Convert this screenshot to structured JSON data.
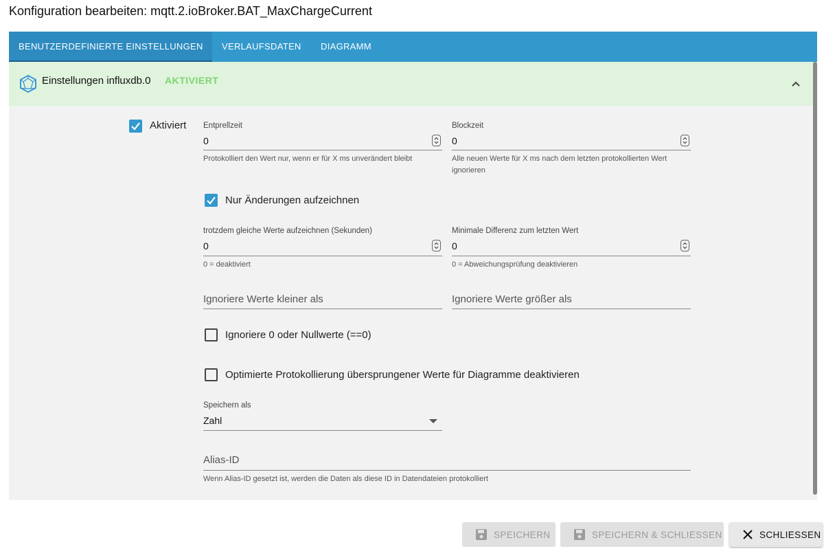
{
  "dialog": {
    "title": "Konfiguration bearbeiten: mqtt.2.ioBroker.BAT_MaxChargeCurrent"
  },
  "tabs": [
    {
      "label": "BENUTZERDEFINIERTE EINSTELLUNGEN",
      "active": true
    },
    {
      "label": "VERLAUFSDATEN",
      "active": false
    },
    {
      "label": "DIAGRAMM",
      "active": false
    }
  ],
  "panel": {
    "title": "Einstellungen influxdb.0",
    "status": "AKTIVIERT",
    "status_color": "#7ed56f",
    "icon": "influxdb-icon",
    "collapse_icon": "chevron-up-icon"
  },
  "form": {
    "enabled": {
      "label": "Aktiviert",
      "checked": true
    },
    "debounce": {
      "label": "Entprellzeit",
      "value": "0",
      "help": "Protokolliert den Wert nur, wenn er für X ms unverändert bleibt"
    },
    "blocktime": {
      "label": "Blockzeit",
      "value": "0",
      "help": "Alle neuen Werte für X ms nach dem letzten protokollierten Wert ignorieren"
    },
    "changes_only": {
      "label": "Nur Änderungen aufzeichnen",
      "checked": true
    },
    "change_min": {
      "label": "trotzdem gleiche Werte aufzeichnen (Sekunden)",
      "value": "0",
      "help": "0 = deaktiviert"
    },
    "min_diff": {
      "label": "Minimale Differenz zum letzten Wert",
      "value": "0",
      "help": "0 = Abweichungsprüfung deaktivieren"
    },
    "ignore_below": {
      "placeholder": "Ignoriere Werte kleiner als"
    },
    "ignore_above": {
      "placeholder": "Ignoriere Werte größer als"
    },
    "ignore_zero": {
      "label": "Ignoriere 0 oder Nullwerte (==0)",
      "checked": false
    },
    "disable_skipped": {
      "label": "Optimierte Protokollierung übersprungener Werte für Diagramme deaktivieren",
      "checked": false
    },
    "store_as": {
      "label": "Speichern als",
      "value": "Zahl"
    },
    "alias": {
      "placeholder": "Alias-ID",
      "help": "Wenn Alias-ID gesetzt ist, werden die Daten als diese ID in Datendateien protokolliert"
    }
  },
  "buttons": {
    "save": {
      "label": "SPEICHERN",
      "icon": "save-icon",
      "disabled": true
    },
    "save_close": {
      "label": "SPEICHERN & SCHLIESSEN",
      "icon": "save-icon",
      "disabled": true
    },
    "close": {
      "label": "SCHLIESSEN",
      "icon": "close-icon",
      "disabled": false
    }
  },
  "colors": {
    "tab_bar": "#3399cc",
    "panel_header": "#dff3dd",
    "checkbox": "#3399cc"
  }
}
